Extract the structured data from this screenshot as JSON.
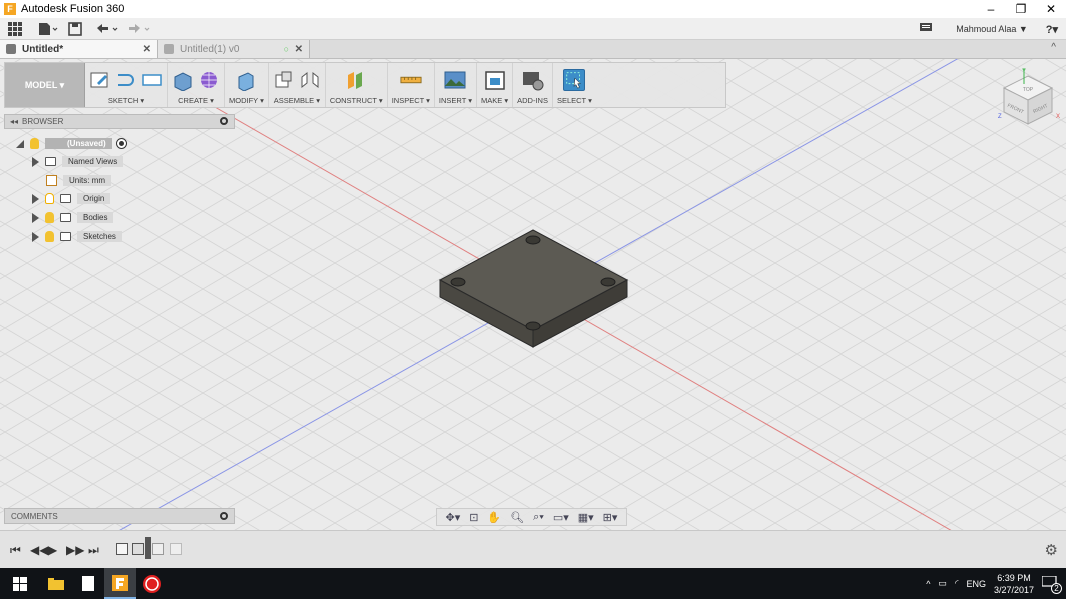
{
  "window": {
    "title": "Autodesk Fusion 360",
    "minimize": "–",
    "restore": "❐",
    "close": "✕"
  },
  "qat": {
    "user": "Mahmoud Alaa ▼",
    "help": "?▾"
  },
  "tabs": [
    {
      "label": "Untitled*",
      "close": "✕"
    },
    {
      "label": "Untitled(1) v0",
      "close": "✕"
    }
  ],
  "tabs_extra": {
    "collapse": "^"
  },
  "toolbar": {
    "workspace": "MODEL ▾",
    "groups": [
      {
        "label": "SKETCH ▾"
      },
      {
        "label": "CREATE ▾"
      },
      {
        "label": "MODIFY ▾"
      },
      {
        "label": "ASSEMBLE ▾"
      },
      {
        "label": "CONSTRUCT ▾"
      },
      {
        "label": "INSPECT ▾"
      },
      {
        "label": "INSERT ▾"
      },
      {
        "label": "MAKE ▾"
      },
      {
        "label": "ADD-INS"
      },
      {
        "label": "SELECT ▾"
      }
    ]
  },
  "browser": {
    "title": "BROWSER",
    "items": [
      {
        "label": "(Unsaved)"
      },
      {
        "label": "Named Views"
      },
      {
        "label": "Units: mm"
      },
      {
        "label": "Origin"
      },
      {
        "label": "Bodies"
      },
      {
        "label": "Sketches"
      }
    ]
  },
  "comments": {
    "title": "COMMENTS"
  },
  "viewcube": {
    "top": "TOP",
    "front": "FRONT",
    "right": "RIGHT",
    "x": "X",
    "y": "Y",
    "z": "Z"
  },
  "taskbar": {
    "lang": "ENG",
    "time": "6:39 PM",
    "date": "3/27/2017",
    "notifications": "2"
  },
  "colors": {
    "accent": "#3c8dc8",
    "body": "#5c5a53",
    "x_axis": "#e05a5a",
    "y_axis": "#5a6ee0"
  }
}
